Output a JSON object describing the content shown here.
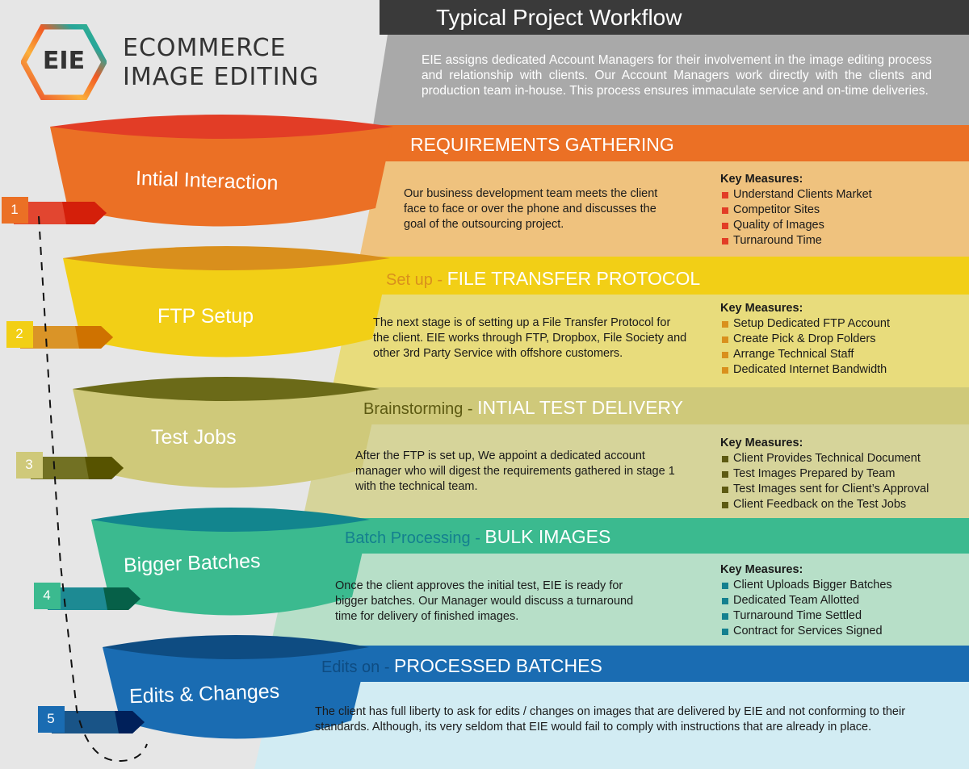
{
  "logo": {
    "mark": "EIE",
    "line1": "ECOMMERCE",
    "line2": "IMAGE EDITING",
    "hex_colors": [
      "#f15a24",
      "#fbb03b",
      "#e8412c",
      "#26a69a",
      "#7b3f9e"
    ]
  },
  "header": {
    "title": "Typical Project Workflow",
    "intro": "EIE assigns dedicated Account Managers for their involvement in the image editing process and relationship with clients. Our Account Managers work directly with the clients and production team in-house. This process ensures immaculate service and on-time deliveries.",
    "title_bg": "#3a3a3a",
    "intro_bg": "#a9a9a9"
  },
  "key_measures_label": "Key Measures:",
  "stages": [
    {
      "number": "1",
      "funnel_label": "Intial Interaction",
      "header_prefix": "",
      "header_title": "REQUIREMENTS GATHERING",
      "description": "Our business development team meets the client face to face or over the phone and discusses the goal of the outsourcing project.",
      "key_measures": [
        "Understand Clients Market",
        "Competitor Sites",
        "Quality of Images",
        "Turnaround Time"
      ],
      "colors": {
        "main": "#eb7025",
        "dark": "#e23d26",
        "panel": "#efc27e",
        "prefix": "#ffffff",
        "bullet": "#e23d26",
        "arrow": "#d41f0a",
        "arrow_light": "#e23d26"
      }
    },
    {
      "number": "2",
      "funnel_label": "FTP Setup",
      "header_prefix": "Set up - ",
      "header_title": "FILE TRANSFER PROTOCOL",
      "description": "The next stage is of setting up a File Transfer Protocol for the client. EIE works through FTP, Dropbox,  File Society and other 3rd Party Service with offshore customers.",
      "key_measures": [
        "Setup Dedicated FTP Account",
        "Create Pick & Drop Folders",
        "Arrange Technical Staff",
        "Dedicated Internet Bandwidth"
      ],
      "colors": {
        "main": "#f2cf16",
        "dark": "#d98f1c",
        "panel": "#e8dc7c",
        "prefix": "#d9901d",
        "bullet": "#d9901d",
        "arrow": "#cf7200",
        "arrow_light": "#d98f1c"
      }
    },
    {
      "number": "3",
      "funnel_label": "Test Jobs",
      "header_prefix": "Brainstorming - ",
      "header_title": "INTIAL TEST DELIVERY",
      "description": "After the FTP is set up, We appoint a dedicated account manager who will digest the requirements gathered in stage 1 with the technical team.",
      "key_measures": [
        "Client Provides Technical Document",
        "Test Images Prepared by Team",
        "Test Images sent for Client’s Approval",
        "Client Feedback on the Test Jobs"
      ],
      "colors": {
        "main": "#cfc97a",
        "dark": "#6b6a18",
        "panel": "#d6d49a",
        "prefix": "#5d5a12",
        "bullet": "#5d5a12",
        "arrow": "#575300",
        "arrow_light": "#6b6a18"
      }
    },
    {
      "number": "4",
      "funnel_label": "Bigger Batches",
      "header_prefix": "Batch Processing - ",
      "header_title": "BULK IMAGES",
      "description": "Once the client approves the initial test, EIE is ready for bigger batches. Our Manager would discuss a turnaround time for delivery of finished images.",
      "key_measures": [
        "Client Uploads Bigger Batches",
        "Dedicated Team Allotted",
        "Turnaround Time Settled",
        "Contract for Services Signed"
      ],
      "colors": {
        "main": "#3bba8f",
        "dark": "#12858e",
        "panel": "#b7dfc8",
        "prefix": "#14808f",
        "bullet": "#14808f",
        "arrow": "#066048",
        "arrow_light": "#12858e"
      }
    },
    {
      "number": "5",
      "funnel_label": "Edits & Changes",
      "header_prefix": "Edits on - ",
      "header_title": "PROCESSED BATCHES",
      "description": "The client has full liberty to ask for edits / changes on images that are delivered by EIE and not conforming to their standards. Although, its  very seldom that EIE would fail to comply with instructions that are already in place.",
      "key_measures": [],
      "colors": {
        "main": "#1a6cb2",
        "dark": "#0e4c82",
        "panel": "#d2ecf3",
        "prefix": "#0e4c82",
        "bullet": "#0e4c82",
        "arrow": "#00205a",
        "arrow_light": "#0e4c82"
      }
    }
  ]
}
